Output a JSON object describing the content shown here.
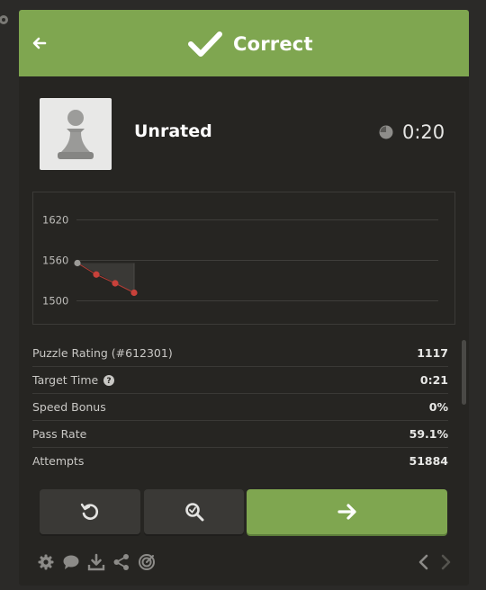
{
  "header": {
    "title": "Correct",
    "accent_color": "#7fa650",
    "back_icon": "arrow-left-icon",
    "status_icon": "checkmark-icon"
  },
  "summary": {
    "piece_icon": "pawn-icon",
    "rating_mode": "Unrated",
    "timer": "0:20",
    "timer_icon": "clock-icon"
  },
  "chart_data": {
    "type": "line",
    "x": [
      0,
      1,
      2,
      3
    ],
    "values": [
      1556,
      1539,
      1526,
      1512
    ],
    "point_colors": [
      "#9b9a97",
      "#c8413a",
      "#c8413a",
      "#c8413a"
    ],
    "ylim": [
      1480,
      1640
    ],
    "yticks": [
      1500,
      1560,
      1620
    ],
    "ytick_labels": [
      "1500",
      "1560",
      "1620"
    ],
    "grid": true
  },
  "stats": [
    {
      "label": "Puzzle Rating (#612301)",
      "value": "1117",
      "has_help": false
    },
    {
      "label": "Target Time",
      "value": "0:21",
      "has_help": true
    },
    {
      "label": "Speed Bonus",
      "value": "0%",
      "has_help": false
    },
    {
      "label": "Pass Rate",
      "value": "59.1%",
      "has_help": false
    },
    {
      "label": "Attempts",
      "value": "51884",
      "has_help": false
    }
  ],
  "actions": {
    "retry_icon": "retry-icon",
    "analyze_icon": "analyze-icon",
    "next_icon": "arrow-right-icon"
  },
  "footer": {
    "icons": [
      "settings-icon",
      "chat-icon",
      "download-icon",
      "share-icon",
      "target-icon",
      "chevron-left-icon",
      "chevron-right-icon"
    ]
  }
}
